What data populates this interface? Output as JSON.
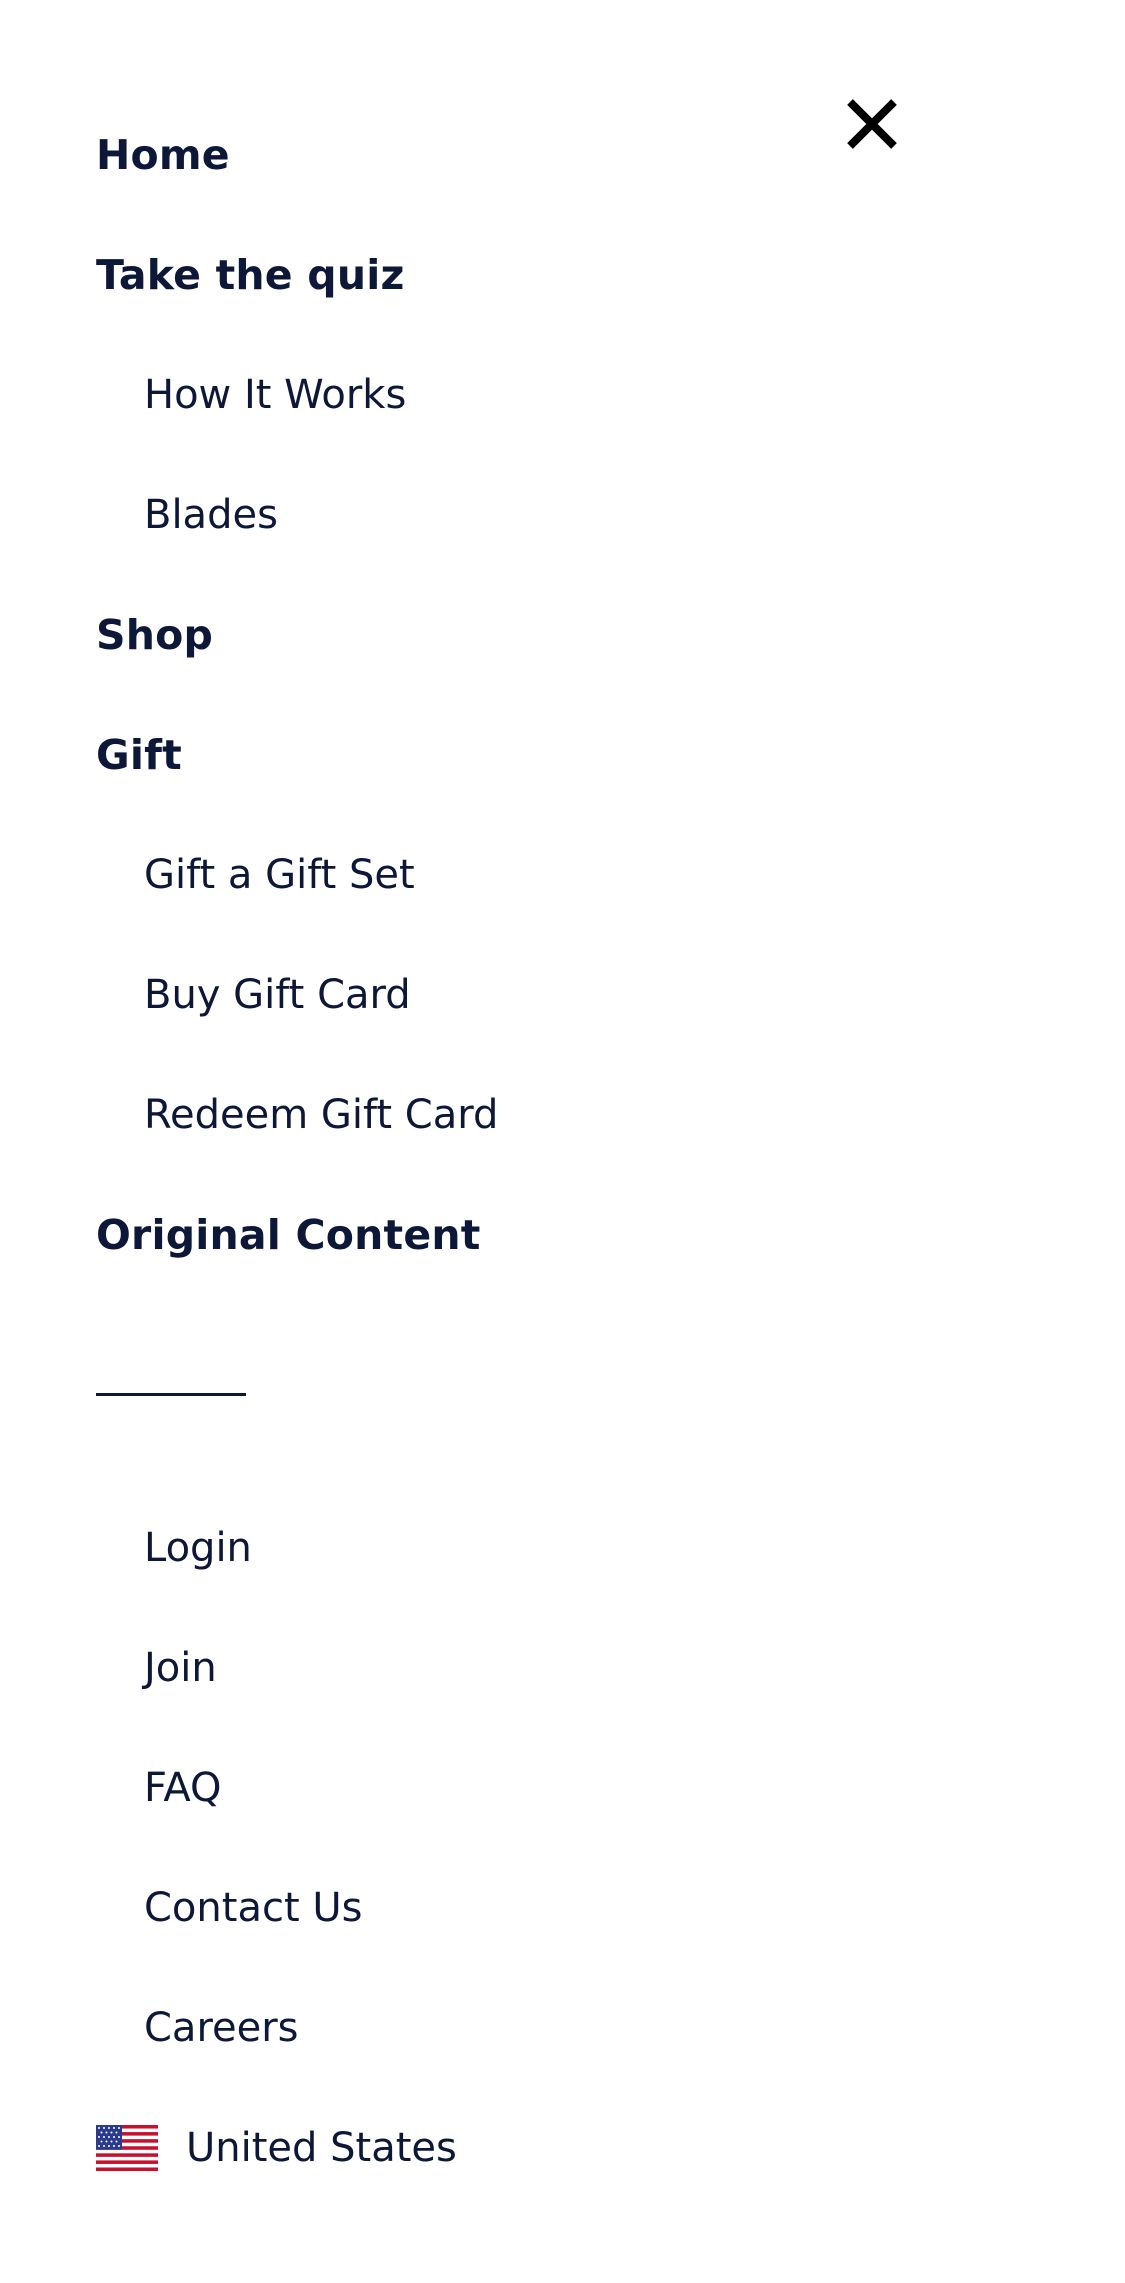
{
  "close": {
    "icon": "close-icon"
  },
  "nav": {
    "home": "Home",
    "quiz": "Take the quiz",
    "how_it_works": "How It Works",
    "blades": "Blades",
    "shop": "Shop",
    "gift": "Gift",
    "gift_set": "Gift a Gift Set",
    "buy_gift_card": "Buy Gift Card",
    "redeem_gift_card": "Redeem Gift Card",
    "original_content": "Original Content"
  },
  "account": {
    "login": "Login",
    "join": "Join",
    "faq": "FAQ",
    "contact": "Contact Us",
    "careers": "Careers"
  },
  "country": {
    "label": "United States",
    "icon": "us-flag-icon"
  },
  "colors": {
    "text": "#0d1738",
    "background": "#ffffff"
  }
}
